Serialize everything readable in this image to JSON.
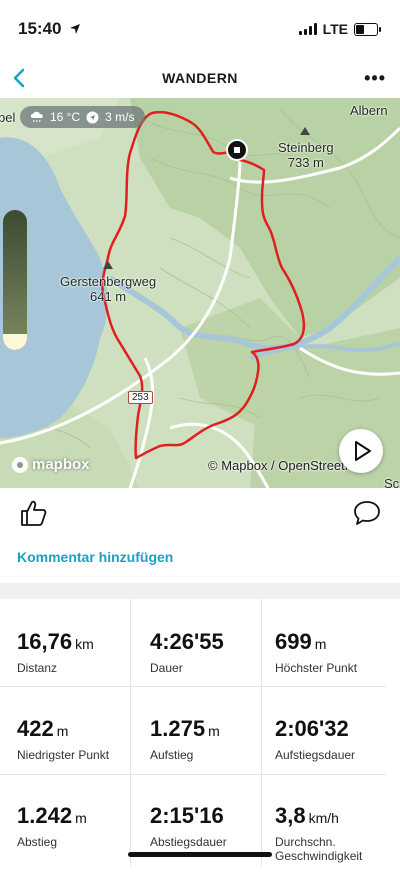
{
  "status_bar": {
    "time": "15:40",
    "network": "LTE"
  },
  "header": {
    "title": "WANDERN",
    "back_icon": "chevron-left-icon",
    "more_label": "•••"
  },
  "accent_color": "#1aa1c7",
  "route_color": "#e02020",
  "map": {
    "weather": {
      "temperature": "16 °C",
      "wind": "3 m/s"
    },
    "labels": {
      "top_left_partial": "bel",
      "albern": "Albern",
      "steinberg": "Steinberg\n733 m",
      "gerstenbergweg": "Gerstenbergweg\n641 m",
      "road_number": "253",
      "bottom_right_partial": "Sc"
    },
    "logo": "mapbox",
    "attribution": "© Mapbox / OpenStreetMap"
  },
  "actions": {
    "add_comment": "Kommentar hinzufügen"
  },
  "stats": [
    {
      "value": "16,76",
      "unit": "km",
      "label": "Distanz"
    },
    {
      "value": "4:26'55",
      "unit": "",
      "label": "Dauer"
    },
    {
      "value": "699",
      "unit": "m",
      "label": "Höchster Punkt"
    },
    {
      "value": "422",
      "unit": "m",
      "label": "Niedrigster Punkt"
    },
    {
      "value": "1.275",
      "unit": "m",
      "label": "Aufstieg"
    },
    {
      "value": "2:06'32",
      "unit": "",
      "label": "Aufstiegsdauer"
    },
    {
      "value": "1.242",
      "unit": "m",
      "label": "Abstieg"
    },
    {
      "value": "2:15'16",
      "unit": "",
      "label": "Abstiegsdauer"
    },
    {
      "value": "3,8",
      "unit": "km/h",
      "label": "Durchschn. Geschwindigkeit"
    }
  ]
}
